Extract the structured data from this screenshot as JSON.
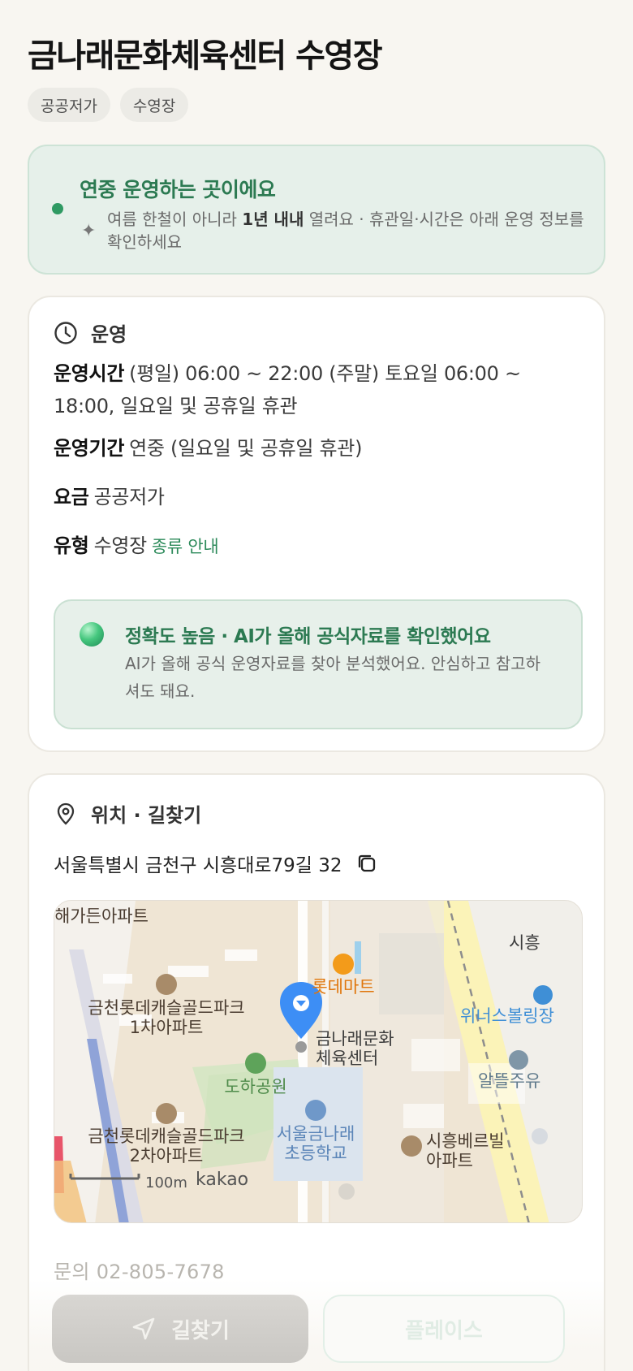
{
  "page": {
    "title": "금나래문화체육센터 수영장",
    "tags": [
      "공공저가",
      "수영장"
    ]
  },
  "notice": {
    "title": "연중 운영하는 곳이에요",
    "sub_pre": "여름 한철이 아니라 ",
    "sub_bold": "1년 내내",
    "sub_post": " 열려요 · 휴관일·시간은 아래 운영 정보를 확인하세요",
    "icon": "sparkle-icon"
  },
  "operation": {
    "header": "운영",
    "icon": "clock-icon",
    "hours_label": "운영시간",
    "hours_value": "(평일) 06:00 ~ 22:00 (주말) 토요일 06:00 ~ 18:00, 일요일 및 공휴일 휴관",
    "period_label": "운영기간",
    "period_value": "연중 (일요일 및 공휴일 휴관)",
    "fee_label": "요금",
    "fee_value": "공공저가",
    "type_label": "유형",
    "type_value": "수영장",
    "type_link": "종류 안내"
  },
  "ai_badge": {
    "title": "정확도 높음 · AI가 올해 공식자료를 확인했어요",
    "desc": "AI가 올해 공식 운영자료를 찾아 분석했어요. 안심하고 참고하셔도 돼요."
  },
  "location": {
    "header": "위치 · 길찾기",
    "icon": "location-pin-icon",
    "address": "서울특별시 금천구 시흥대로79길 32",
    "copy_icon": "copy-icon",
    "map": {
      "labels": {
        "apt_top": "해가든아파트",
        "apt1_line1": "금천롯데캐슬골드파크",
        "apt1_line2": "1차아파트",
        "mart": "롯데마트",
        "center_line1": "금나래문화",
        "center_line2": "체육센터",
        "park": "도하공원",
        "school_line1": "서울금나래",
        "school_line2": "초등학교",
        "apt2_line1": "금천롯데캐슬골드파크",
        "apt2_line2": "2차아파트",
        "apt3_line1": "시흥베르빌",
        "apt3_line2": "아파트",
        "bowling": "위너스볼링장",
        "gas": "알뜰주유",
        "siheung": "시흥",
        "scale": "100m",
        "brand": "kakao"
      }
    },
    "phone": "문의 02-805-7678"
  },
  "actions": {
    "directions": "길찾기",
    "directions_icon": "navigate-arrow-icon",
    "place": "플레이스"
  },
  "colors": {
    "accent_green": "#2c7a52",
    "map_pin_blue": "#3d8ef5"
  }
}
